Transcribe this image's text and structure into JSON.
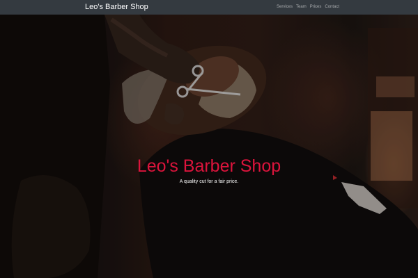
{
  "navbar": {
    "brand": "Leo's Barber Shop",
    "links": [
      "Services",
      "Team",
      "Prices",
      "Contact"
    ]
  },
  "hero": {
    "title": "Leo's Barber Shop",
    "subtitle": "A quality cut for a fair price.",
    "image_subject": "barber trimming a bearded man's beard with scissors"
  },
  "colors": {
    "navbar_bg": "#343a40",
    "title": "#dc143c",
    "text": "#ffffff",
    "nav_link": "rgba(255,255,255,0.55)"
  }
}
